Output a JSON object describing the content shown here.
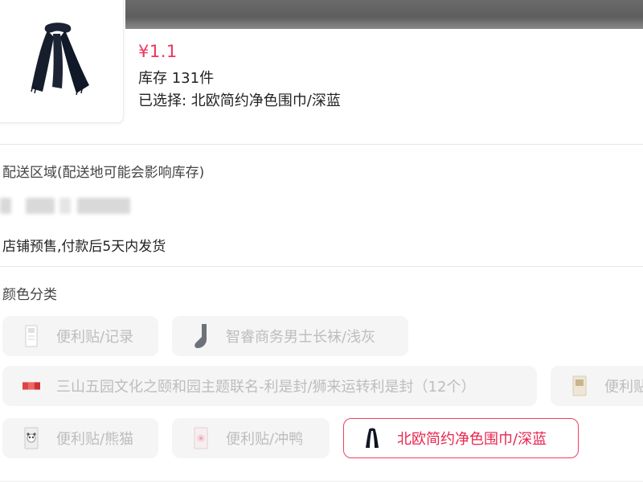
{
  "product": {
    "price": "¥1.1",
    "stock": "库存 131件",
    "selected": "已选择: 北欧简约净色围巾/深蓝",
    "image_icon": "scarf-icon"
  },
  "delivery": {
    "label": "配送区域(配送地可能会影响库存)",
    "shipping_note": "店铺预售,付款后5天内发货"
  },
  "variants": {
    "label": "颜色分类",
    "options": [
      {
        "label": "便利贴/记录",
        "icon": "sticky-note-icon",
        "selected": false
      },
      {
        "label": "智睿商务男士长袜/浅灰",
        "icon": "sock-icon",
        "selected": false
      },
      {
        "label": "三山五园文化之颐和园主题联名-利是封/狮来运转利是封（12个）",
        "icon": "red-envelope-icon",
        "selected": false
      },
      {
        "label": "便利贴",
        "icon": "sticky-note-icon",
        "selected": false
      },
      {
        "label": "便利贴/熊猫",
        "icon": "panda-note-icon",
        "selected": false
      },
      {
        "label": "便利贴/冲鸭",
        "icon": "duck-note-icon",
        "selected": false
      },
      {
        "label": "北欧简约净色围巾/深蓝",
        "icon": "scarf-icon",
        "selected": true
      }
    ]
  },
  "colors": {
    "accent": "#f0335c",
    "chip_bg": "#f5f5f5",
    "top_bar": "#666666"
  }
}
